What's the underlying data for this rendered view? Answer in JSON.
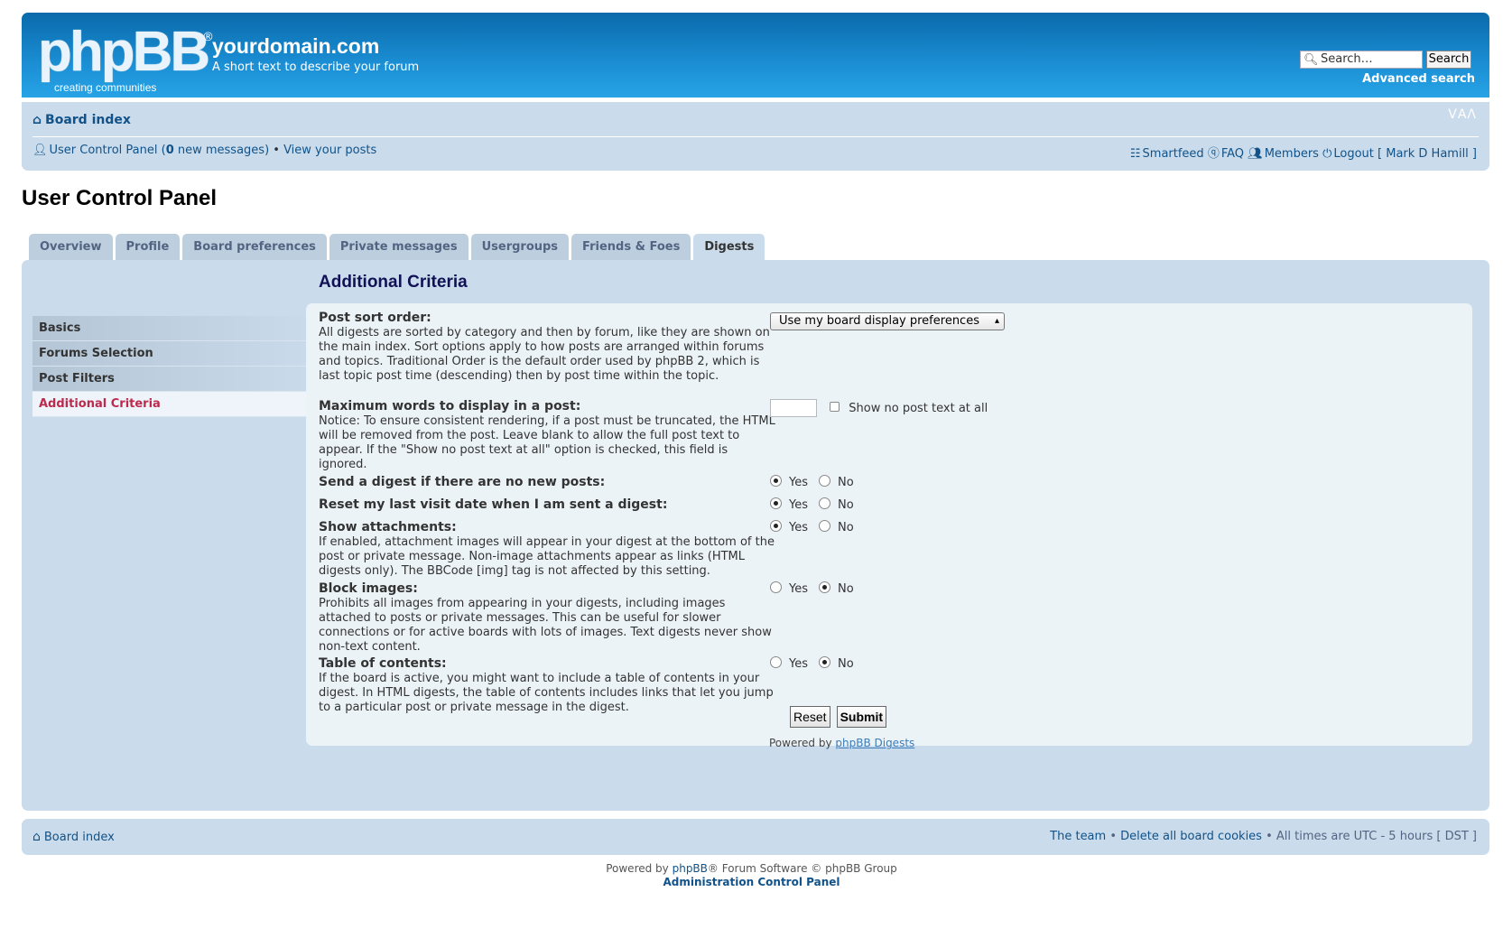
{
  "header": {
    "logo_text": "phpBB",
    "logo_reg": "®",
    "logo_sub": "creating  communities",
    "site_title": "yourdomain.com",
    "site_desc": "A short text to describe your forum",
    "search_placeholder": "Search…",
    "search_button": "Search",
    "advanced_search": "Advanced search"
  },
  "navbar": {
    "board_index": "Board index",
    "fontsize": "ᐯAᐱ",
    "ucp_prefix": "User Control Panel (",
    "new_count": "0",
    "ucp_suffix": " new messages)",
    "bullet": " • ",
    "view_posts": "View your posts",
    "smartfeed": "Smartfeed",
    "faq": "FAQ",
    "members": "Members",
    "logout": "Logout [ Mark D Hamill ]"
  },
  "page_title": "User Control Panel",
  "tabs": [
    {
      "label": "Overview",
      "active": false
    },
    {
      "label": "Profile",
      "active": false
    },
    {
      "label": "Board preferences",
      "active": false
    },
    {
      "label": "Private messages",
      "active": false
    },
    {
      "label": "Usergroups",
      "active": false
    },
    {
      "label": "Friends & Foes",
      "active": false
    },
    {
      "label": "Digests",
      "active": true
    }
  ],
  "menu": [
    {
      "label": "Basics",
      "active": false
    },
    {
      "label": "Forums Selection",
      "active": false
    },
    {
      "label": "Post Filters",
      "active": false
    },
    {
      "label": "Additional Criteria",
      "active": true
    }
  ],
  "section_title": "Additional Criteria",
  "fields": {
    "sort": {
      "label": "Post sort order:",
      "desc": "All digests are sorted by category and then by forum, like they are shown on the main index. Sort options apply to how posts are arranged within forums and topics. Traditional Order is the default order used by phpBB 2, which is last topic post time (descending) then by post time within the topic.",
      "selected": "Use my board display preferences"
    },
    "maxwords": {
      "label": "Maximum words to display in a post:",
      "desc": "Notice: To ensure consistent rendering, if a post must be truncated, the HTML will be removed from the post. Leave blank to allow the full post text to appear. If the \"Show no post text at all\" option is checked, this field is ignored.",
      "value": "",
      "checkbox_label": "Show no post text at all"
    },
    "send_empty": {
      "label": "Send a digest if there are no new posts:",
      "desc": "",
      "yes": "Yes",
      "no": "No"
    },
    "reset_visit": {
      "label": "Reset my last visit date when I am sent a digest:",
      "desc": "",
      "yes": "Yes",
      "no": "No"
    },
    "attachments": {
      "label": "Show attachments:",
      "desc": "If enabled, attachment images will appear in your digest at the bottom of the post or private message. Non-image attachments appear as links (HTML digests only). The BBCode [img] tag is not affected by this setting.",
      "yes": "Yes",
      "no": "No"
    },
    "block_images": {
      "label": "Block images:",
      "desc": "Prohibits all images from appearing in your digests, including images attached to posts or private messages. This can be useful for slower connections or for active boards with lots of images. Text digests never show non-text content.",
      "yes": "Yes",
      "no": "No"
    },
    "toc": {
      "label": "Table of contents:",
      "desc": "If the board is active, you might want to include a table of contents in your digest. In HTML digests, the table of contents includes links that let you jump to a particular post or private message in the digest.",
      "yes": "Yes",
      "no": "No"
    }
  },
  "buttons": {
    "reset": "Reset",
    "submit": "Submit"
  },
  "powered_digests": {
    "prefix": "Powered by ",
    "link": "phpBB Digests"
  },
  "footer": {
    "board_index": "Board index",
    "team": "The team",
    "bullet": " • ",
    "delete_cookies": "Delete all board cookies",
    "times": "All times are UTC - 5 hours [ DST ]"
  },
  "copyright": {
    "prefix": "Powered by ",
    "phpbb": "phpBB",
    "suffix": "® Forum Software © phpBB Group",
    "acp": "Administration Control Panel"
  }
}
